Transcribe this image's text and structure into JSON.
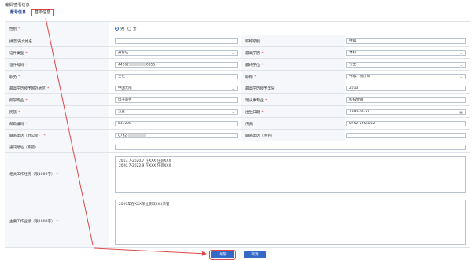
{
  "window": {
    "title": "编辑/查看信息"
  },
  "tabs": [
    {
      "label": "账号信息"
    },
    {
      "label": "基本信息"
    }
  ],
  "form": {
    "gender": {
      "label": "性别",
      "options": [
        "男",
        "女"
      ],
      "selected": "男"
    },
    "pinyin_name": {
      "label": "拼音/英文姓名",
      "value": ""
    },
    "title_level": {
      "label": "职称级别",
      "value": "中级"
    },
    "id_type": {
      "label": "证件类型",
      "value": "身份证"
    },
    "highest_education": {
      "label": "最高学历",
      "value": "本科"
    },
    "id_number": {
      "label": "证件号码",
      "value_prefix": "44162",
      "value_suffix": "0855"
    },
    "highest_degree": {
      "label": "最终学位",
      "value": "学士"
    },
    "position": {
      "label": "职务",
      "value": "主任"
    },
    "professional_title": {
      "label": "职称",
      "value": "中级：统计师"
    },
    "edu_region": {
      "label": "最高学历授予国外地区",
      "value": "中国大陆"
    },
    "edu_year": {
      "label": "最高学历授予年份",
      "value": "2013"
    },
    "major": {
      "label": "所学专业",
      "value": "电子商务"
    },
    "current_major": {
      "label": "现从事专业",
      "value": "科技金融"
    },
    "ethnicity": {
      "label": "民族",
      "value": "汉族"
    },
    "birth_date": {
      "label": "出生日期",
      "value": "1990-06-22"
    },
    "postal_code": {
      "label": "邮政编码",
      "value": "517200"
    },
    "fax": {
      "label": "传真",
      "value": "0762-5555882"
    },
    "office_phone": {
      "label": "联系电话（办公室）",
      "value_prefix": "0762-"
    },
    "home_phone": {
      "label": "联系电话（住宅）",
      "value": ""
    },
    "address": {
      "label": "通讯地址（家庭）",
      "value": ""
    },
    "experience": {
      "label": "相关工作经历（限1000字）",
      "lines": [
        "2013.7-2020.7  在XXX  任职XXX",
        "2020.7-2022.9  在XXX  任职XXX"
      ]
    },
    "achievements": {
      "label": "主要工作业绩（限1000字）",
      "lines": [
        "2020年在XXX单位获取XXX荣誉"
      ]
    }
  },
  "buttons": {
    "save": "保存",
    "cancel": "取消"
  },
  "colors": {
    "accent": "#3569c7",
    "required": "#e03a3a",
    "highlight": "#e04848"
  }
}
